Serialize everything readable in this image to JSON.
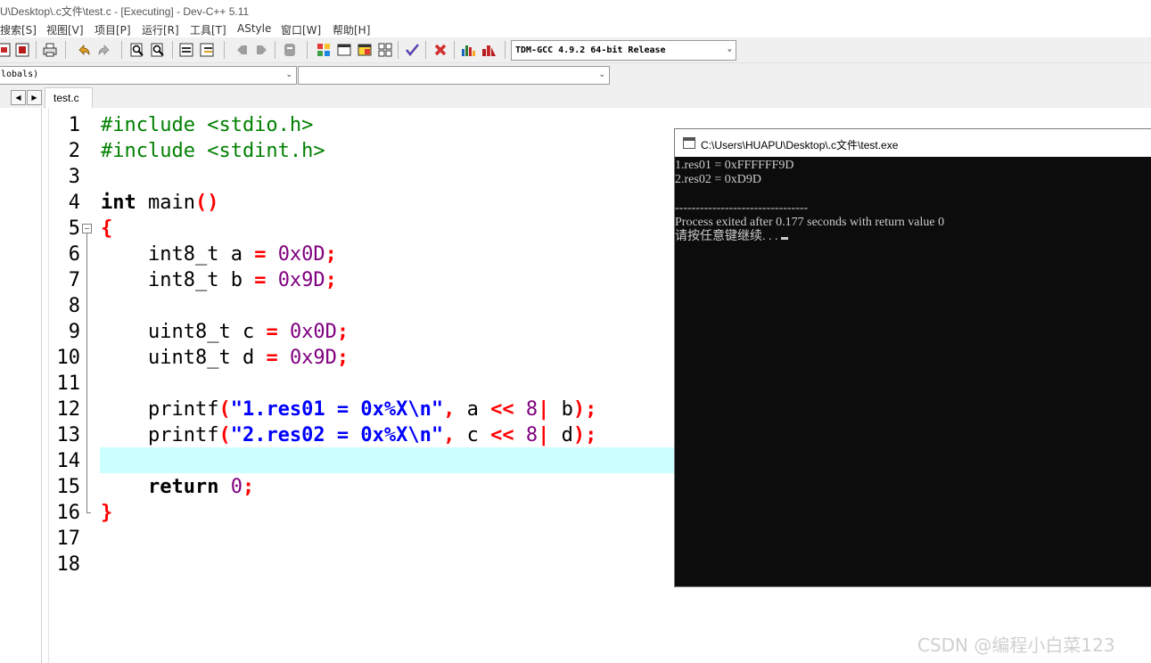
{
  "window": {
    "title": "U\\Desktop\\.c文件\\test.c - [Executing] - Dev-C++ 5.11"
  },
  "menu": [
    "搜索[S]",
    "视图[V]",
    "项目[P]",
    "运行[R]",
    "工具[T]",
    "AStyle",
    "窗口[W]",
    "帮助[H]"
  ],
  "toolbar": {
    "compiler": "TDM-GCC 4.9.2 64-bit Release",
    "icons": [
      "new-icon",
      "project-icon",
      "print-icon",
      "undo-icon",
      "redo-icon",
      "find-icon",
      "replace-icon",
      "indent-icon",
      "unindent-icon",
      "bookmark-icon",
      "goto-icon",
      "compile-icon",
      "run-icon",
      "compile-run-icon",
      "rebuild-icon",
      "check-icon",
      "stop-icon",
      "chart-icon",
      "debug-icon"
    ]
  },
  "classbrowser": {
    "scope": "lobals)",
    "member": ""
  },
  "tabs": [
    {
      "label": "test.c"
    }
  ],
  "editor": {
    "lines": [
      {
        "n": "1"
      },
      {
        "n": "2"
      },
      {
        "n": "3"
      },
      {
        "n": "4"
      },
      {
        "n": "5"
      },
      {
        "n": "6"
      },
      {
        "n": "7"
      },
      {
        "n": "8"
      },
      {
        "n": "9"
      },
      {
        "n": "10"
      },
      {
        "n": "11"
      },
      {
        "n": "12"
      },
      {
        "n": "13"
      },
      {
        "n": "14"
      },
      {
        "n": "15"
      },
      {
        "n": "16"
      },
      {
        "n": "17"
      },
      {
        "n": "18"
      }
    ],
    "code": {
      "l1": "#include <stdio.h>",
      "l2": "#include <stdint.h>",
      "l4_kw": "int",
      "l4_rest": " main",
      "l4_paren": "()",
      "l5": "{",
      "l6_type": "    int8_t a ",
      "l6_eq": "=",
      "l6_sp": " ",
      "l6_val": "0x0D",
      "l6_semi": ";",
      "l7_type": "    int8_t b ",
      "l7_eq": "=",
      "l7_sp": " ",
      "l7_val": "0x9D",
      "l7_semi": ";",
      "l9_type": "    uint8_t c ",
      "l9_eq": "=",
      "l9_sp": " ",
      "l9_val": "0x0D",
      "l9_semi": ";",
      "l10_type": "    uint8_t d ",
      "l10_eq": "=",
      "l10_sp": " ",
      "l10_val": "0x9D",
      "l10_semi": ";",
      "l12_fn": "    printf",
      "l12_open": "(",
      "l12_str": "\"1.res01 = 0x%X\\n\"",
      "l12_comma": ",",
      "l12_a": " a ",
      "l12_shift": "<<",
      "l12_sp": " ",
      "l12_8": "8",
      "l12_or": "|",
      "l12_b": " b",
      "l12_close": ");",
      "l13_fn": "    printf",
      "l13_open": "(",
      "l13_str": "\"2.res02 = 0x%X\\n\"",
      "l13_comma": ",",
      "l13_c": " c ",
      "l13_shift": "<<",
      "l13_sp": " ",
      "l13_8": "8",
      "l13_or": "|",
      "l13_d": " d",
      "l13_close": ");",
      "l15_ind": "    ",
      "l15_kw": "return",
      "l15_sp": " ",
      "l15_val": "0",
      "l15_semi": ";",
      "l16": "}"
    }
  },
  "console": {
    "title": "C:\\Users\\HUAPU\\Desktop\\.c文件\\test.exe",
    "lines": [
      "1.res01 = 0xFFFFFF9D",
      "2.res02 = 0xD9D",
      "",
      "--------------------------------",
      "Process exited after 0.177 seconds with return value 0",
      "请按任意键继续. . . "
    ]
  },
  "watermark": "CSDN @编程小白菜123",
  "colors": {
    "current_line": "#ccffff",
    "preprocessor": "#008000",
    "symbol": "#ff0000",
    "number": "#800080",
    "string": "#0000ff",
    "console_bg": "#0c0c0c"
  }
}
